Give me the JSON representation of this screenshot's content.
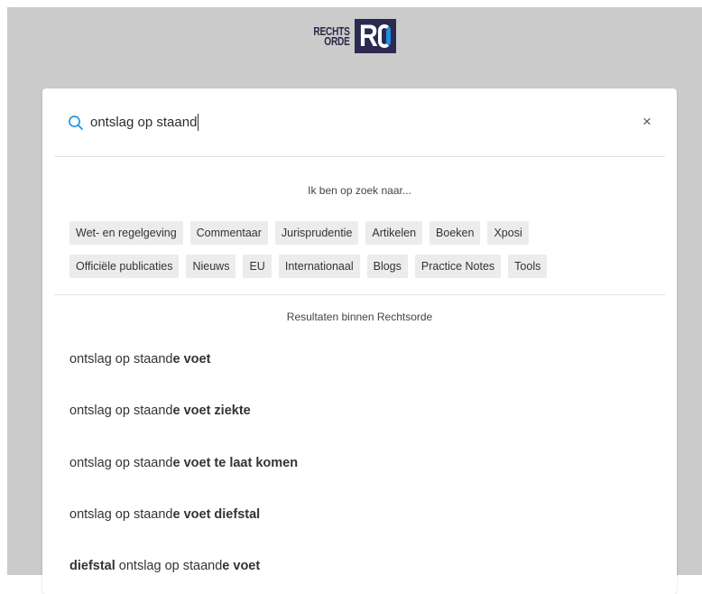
{
  "logo": {
    "line1": "RECHTS",
    "line2": "ORDE",
    "mark": "R"
  },
  "search": {
    "value": "ontslag op staand",
    "icon": "search-icon",
    "close_label": "×"
  },
  "lookfor": {
    "heading": "Ik ben op zoek naar...",
    "row1": [
      "Wet- en regelgeving",
      "Commentaar",
      "Jurisprudentie",
      "Artikelen",
      "Boeken",
      "Xposi"
    ],
    "row2": [
      "Officiële publicaties",
      "Nieuws",
      "EU",
      "Internationaal",
      "Blogs",
      "Practice Notes",
      "Tools"
    ]
  },
  "results": {
    "heading": "Resultaten binnen Rechtsorde",
    "items": [
      {
        "pre": "",
        "pre_bold": "",
        "plain": "ontslag op staand",
        "bold": "e voet"
      },
      {
        "pre": "",
        "pre_bold": "",
        "plain": "ontslag op staand",
        "bold": "e voet ziekte"
      },
      {
        "pre": "",
        "pre_bold": "",
        "plain": "ontslag op staand",
        "bold": "e voet te laat komen"
      },
      {
        "pre": "",
        "pre_bold": "",
        "plain": "ontslag op staand",
        "bold": "e voet diefstal"
      },
      {
        "pre": "",
        "pre_bold": "diefstal",
        "plain": " ontslag op staand",
        "bold": "e voet"
      }
    ]
  },
  "colors": {
    "accent": "#1f8fe0",
    "brand": "#2d2a52",
    "backdrop": "#cbcbcb",
    "chip": "#ececec"
  }
}
